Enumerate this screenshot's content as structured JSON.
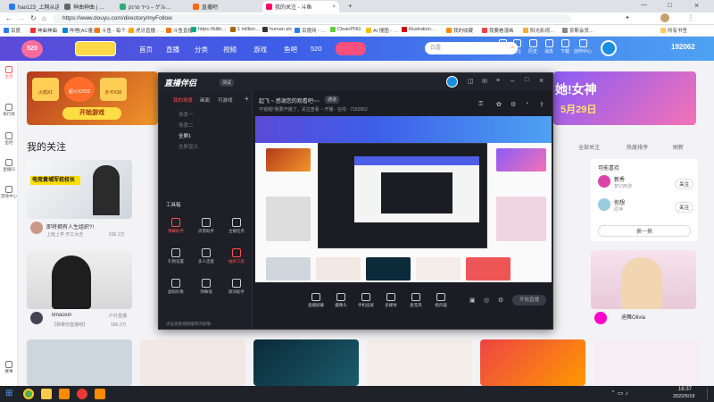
{
  "browser": {
    "tabs": [
      {
        "title": "hao123_上网从这里开始",
        "color": "#2a7cf6"
      },
      {
        "title": "神曲神曲 | …",
        "color": "#666"
      },
      {
        "title": "נייד פרנק – ゲル…",
        "color": "#3a7"
      },
      {
        "title": "直播吧",
        "color": "#f60"
      },
      {
        "title": "我的关注 - 斗鱼",
        "color": "#f06"
      }
    ],
    "url": "https://www.douyu.com/directory/myFollow",
    "bookmarks": [
      "百度",
      "神曲神曲",
      "哔哩(AC番)",
      "斗鱼 - 每个…",
      "虎牙直播 - …",
      "斗鱼直播",
      "https://bilib…",
      "1 million…",
      "human pic",
      "百度网 - …",
      "CleanPNG",
      "AI 搜图 - …",
      "illustration…",
      "我的收藏",
      "我要看漫画",
      "阳光影视…",
      "奈斯会员…",
      "所有书签"
    ]
  },
  "site": {
    "nav": [
      "首页",
      "直播",
      "分类",
      "视频",
      "游戏",
      "鱼吧",
      "520"
    ],
    "search_placeholder": "白露",
    "header_icons": [
      "登录",
      "关注",
      "历史",
      "消息",
      "下载",
      "创作中心",
      "开播"
    ],
    "follower_count": "192062",
    "event_banner": "520",
    "banner_left": {
      "tiles": [
        "火箭X1",
        "超火X2022",
        "办卡X30"
      ],
      "button": "开始游戏"
    },
    "banner_right": "她!女神",
    "banner_date": "5月29日",
    "section_title": "我的关注",
    "sort_left": "全部关注",
    "sort_right": "热度排序",
    "sort_button": "刷新",
    "side_panel_title": "可能喜欢",
    "side_panel_items": [
      {
        "name": "新秀",
        "sub": "梦幻西游",
        "btn": "关注"
      },
      {
        "name": "你想",
        "sub": "原神",
        "btn": "关注"
      }
    ],
    "change_batch": "换一换",
    "cards": [
      {
        "title": "即将拥有人生组织?!",
        "streamer": "上班上学 开工大吉",
        "views": "536.1万",
        "overlay": "电竞黄埔军校校长"
      },
      {
        "title": "我的关注",
        "streamer": "",
        "views": "",
        "overlay": ""
      },
      {
        "title": "【我带你直播吧】",
        "streamer": "timaoxin",
        "views": "186.2万",
        "tag": "户外直播"
      },
      {
        "title": "",
        "streamer": "",
        "views": "",
        "overlay": ""
      },
      {
        "title": "迪舞Olivia",
        "streamer": "迪舞 Olivia",
        "views": "",
        "tag": ""
      }
    ],
    "sidebar": [
      "主页",
      "排行榜",
      "鱼吧",
      "直播间",
      "游戏中心",
      "赛事"
    ]
  },
  "app": {
    "logo": "直播伴侣",
    "badge": "测试",
    "tabs": [
      "我的场景",
      "画面",
      "可游戏"
    ],
    "scenes": [
      "场景一",
      "场景二",
      "全屏1",
      "全屏显示"
    ],
    "stream_title": "起飞 ~ 感谢您的观看吧~~",
    "stream_tag": "通道",
    "stream_info": "不错喔!!我要开播了，关注查看 ~  开播 · 在线 · 7182962",
    "toolbox_title": "工具箱",
    "tools": [
      "弹幕助手",
      "房管助手",
      "主播任务",
      "礼物设置",
      "多人连麦",
      "抽奖工具",
      "虚拟形象",
      "弹幕墙",
      "歌词助手",
      "视频工具",
      "PK",
      "更多"
    ],
    "bottom_tools": [
      "直播屏幕",
      "摄像头",
      "手机投屏",
      "多媒体",
      "麦克风",
      "扬声器"
    ],
    "start_button": "开始直播",
    "hint": "点击查看视频推荐内容哦~"
  },
  "taskbar": {
    "time": "16:37",
    "date": "2022/5/19"
  }
}
